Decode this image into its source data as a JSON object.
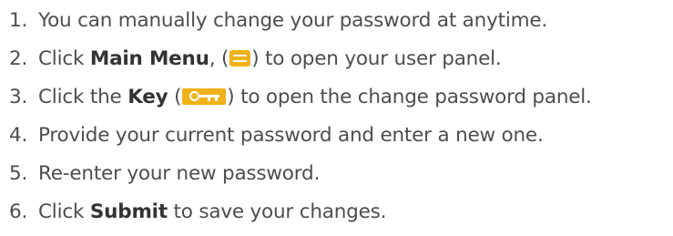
{
  "steps": [
    {
      "number": "1.",
      "text": "You can manually change your password at anytime."
    },
    {
      "number": "2.",
      "pre": "Click ",
      "bold": "Main Menu",
      "mid": ", (",
      "icon": "menu-icon",
      "post": ") to open your user panel."
    },
    {
      "number": "3.",
      "pre": "Click the ",
      "bold": "Key",
      "mid": " (",
      "icon": "key-icon",
      "post": ") to open the change password panel."
    },
    {
      "number": "4.",
      "text": "Provide your current password and enter a new one."
    },
    {
      "number": "5.",
      "text": "Re-enter your new password."
    },
    {
      "number": "6.",
      "pre": "Click ",
      "bold": "Submit",
      "post": " to save your changes."
    }
  ],
  "colors": {
    "text": "#4d4d4d",
    "icon_accent": "#f0b21b"
  }
}
